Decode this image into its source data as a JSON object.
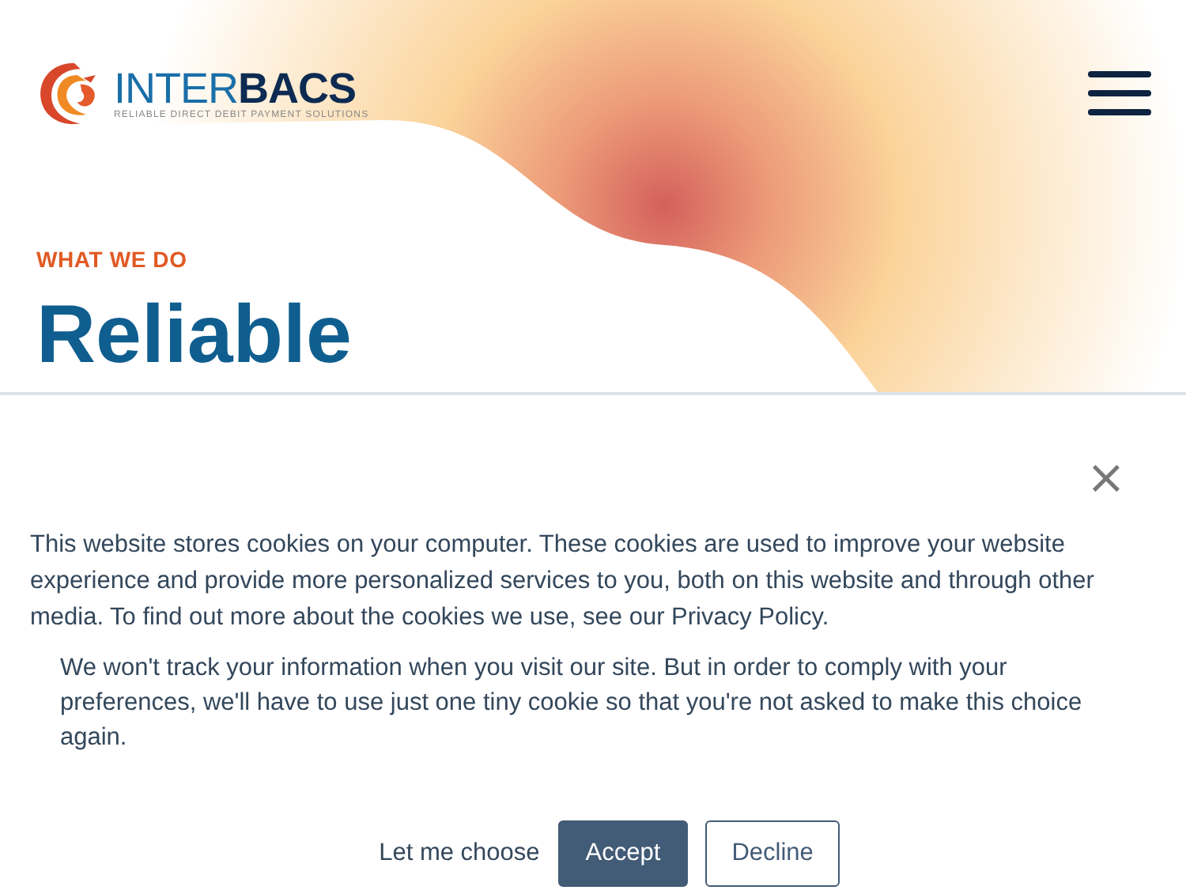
{
  "header": {
    "logo": {
      "light": "INTER",
      "bold": "BACS",
      "tagline": "RELIABLE DIRECT DEBIT PAYMENT SOLUTIONS"
    }
  },
  "hero": {
    "eyebrow": "WHAT WE DO",
    "heading": "Reliable"
  },
  "cookie_banner": {
    "close": "×",
    "message": "This website stores cookies on your computer. These cookies are used to improve your website experience and provide more personalized services to you, both on this website and through other media. To find out more about the cookies we use, see our Privacy Policy.",
    "note": "We won't track your information when you visit our site. But in order to comply with your preferences, we'll have to use just one tiny cookie so that you're not asked to make this choice again.",
    "buttons": [
      {
        "label": "Let me choose",
        "kind": "link"
      },
      {
        "label": "Accept",
        "kind": "primary"
      },
      {
        "label": "Decline",
        "kind": "outline"
      }
    ]
  }
}
